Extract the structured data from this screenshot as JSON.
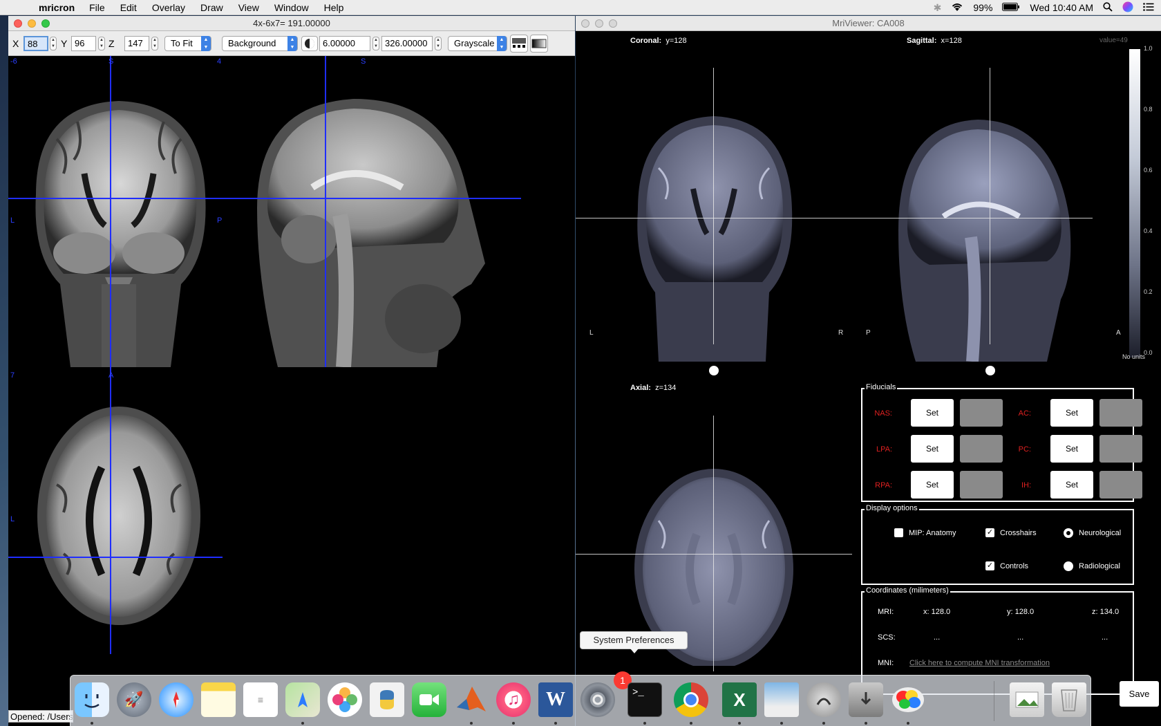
{
  "menubar": {
    "app_name": "mricron",
    "items": [
      "File",
      "Edit",
      "Overlay",
      "Draw",
      "View",
      "Window",
      "Help"
    ],
    "battery": "99%",
    "clock": "Wed 10:40 AM"
  },
  "mricron": {
    "title": "4x-6x7= 191.00000",
    "x_label": "X",
    "x_value": "88",
    "y_label": "Y",
    "y_value": "96",
    "z_label": "Z",
    "z_value": "147",
    "fit_select": "To Fit",
    "background_select": "Background",
    "min_value": "6.00000",
    "max_value": "326.00000",
    "colormap_select": "Grayscale",
    "coronal_corner": "-6",
    "coronal_top": "S",
    "coronal_left": "L",
    "sagittal_corner": "4",
    "sagittal_top": "S",
    "sagittal_left": "P",
    "axial_corner": "7",
    "axial_top": "A",
    "axial_left": "L",
    "status": "Opened: /Users"
  },
  "mriviewer": {
    "title": "MriViewer: CA008",
    "coronal_label": "Coronal:",
    "coronal_value": "y=128",
    "sagittal_label": "Sagittal:",
    "sagittal_value": "x=128",
    "axial_label": "Axial:",
    "axial_value": "z=134",
    "value_readout": "value=49",
    "coronal_L": "L",
    "coronal_R": "R",
    "sagittal_P": "P",
    "sagittal_A": "A",
    "colorbar_ticks": [
      "1.0",
      "0.8",
      "0.6",
      "0.4",
      "0.2",
      "0.0"
    ],
    "colorbar_units": "No units",
    "fiducials": {
      "title": "Fiducials",
      "set_label": "Set",
      "labels": [
        "NAS:",
        "LPA:",
        "RPA:",
        "AC:",
        "PC:",
        "IH:"
      ]
    },
    "display_options": {
      "title": "Display options",
      "mip": "MIP: Anatomy",
      "crosshairs": "Crosshairs",
      "controls": "Controls",
      "neurological": "Neurological",
      "radiological": "Radiological"
    },
    "coordinates": {
      "title": "Coordinates (milimeters)",
      "mri_label": "MRI:",
      "mri_x": "x: 128.0",
      "mri_y": "y: 128.0",
      "mri_z": "z: 134.0",
      "scs_label": "SCS:",
      "scs_x": "...",
      "scs_y": "...",
      "scs_z": "...",
      "mni_label": "MNI:",
      "mni_link": "Click here to compute MNI transformation"
    },
    "save_label": "Save"
  },
  "tooltip": "System Preferences",
  "dock": {
    "badge_count": "1",
    "apps": [
      "finder-icon",
      "launchpad-icon",
      "safari-icon",
      "notes-icon",
      "reminders-icon",
      "maps-icon",
      "photos-icon",
      "python-icon",
      "facetime-icon",
      "matlab-icon",
      "itunes-icon",
      "word-icon",
      "system-preferences-icon",
      "terminal-icon",
      "chrome-icon",
      "excel-icon",
      "preview-icon",
      "disk-utility-icon",
      "installer-icon",
      "mricron-dock-icon",
      "image-file-icon",
      "trash-icon"
    ]
  }
}
